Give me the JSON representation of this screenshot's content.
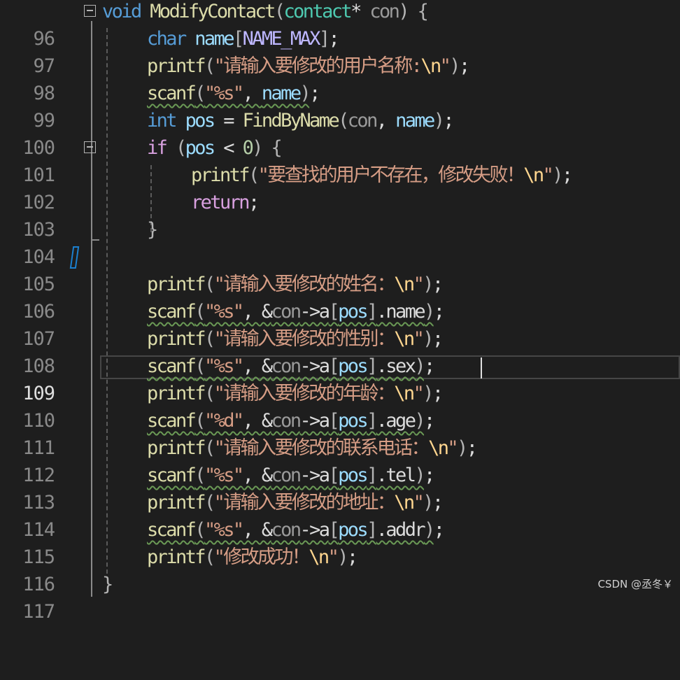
{
  "editor": {
    "lines": [
      {
        "num": "96"
      },
      {
        "num": "97"
      },
      {
        "num": "98"
      },
      {
        "num": "99"
      },
      {
        "num": "100"
      },
      {
        "num": "101"
      },
      {
        "num": "102"
      },
      {
        "num": "103"
      },
      {
        "num": "104"
      },
      {
        "num": "105"
      },
      {
        "num": "106"
      },
      {
        "num": "107"
      },
      {
        "num": "108"
      },
      {
        "num": "109"
      },
      {
        "num": "110"
      },
      {
        "num": "111"
      },
      {
        "num": "112"
      },
      {
        "num": "113"
      },
      {
        "num": "114"
      },
      {
        "num": "115"
      },
      {
        "num": "116"
      },
      {
        "num": "117"
      }
    ],
    "current_line": "109",
    "colors": {
      "background": "#1e1e1e",
      "keyword": "#569cd6",
      "control_keyword": "#d8a0df",
      "function": "#dcdcaa",
      "type": "#4ec9b0",
      "string": "#d69d85",
      "escape": "#ffd68f",
      "local_variable": "#9cdcfe",
      "parameter": "#9a9a9a",
      "macro": "#beb7ff",
      "number": "#b5cea8",
      "squiggle": "#6a9955",
      "change_marker": "#1b80d0"
    }
  },
  "watermark": "CSDN @丞冬￥"
}
